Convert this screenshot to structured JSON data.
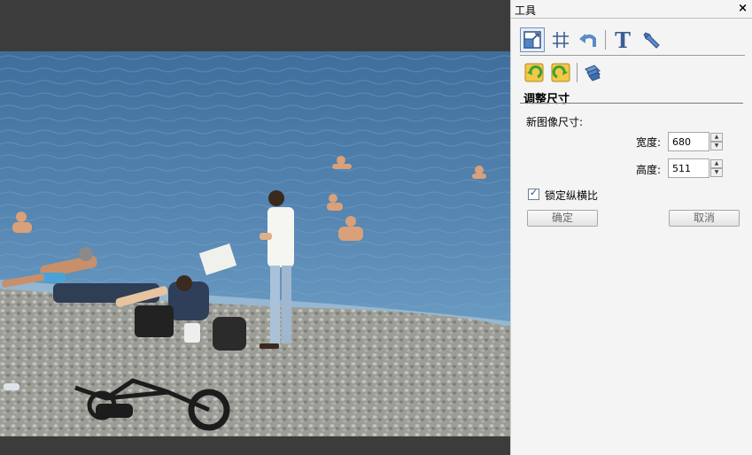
{
  "panel": {
    "title": "工具",
    "close_glyph": "×"
  },
  "toolbar": {
    "row1": [
      {
        "name": "resize-icon",
        "active": true
      },
      {
        "name": "crop-icon",
        "active": false
      },
      {
        "name": "undo-icon",
        "active": false
      },
      {
        "name": "text-icon",
        "label": "T"
      },
      {
        "name": "wrench-icon"
      }
    ],
    "row2": [
      {
        "name": "rotate-left-icon"
      },
      {
        "name": "rotate-right-icon"
      },
      {
        "name": "effects-icon"
      }
    ]
  },
  "resize": {
    "section_title": "调整尺寸",
    "new_size_label": "新图像尺寸:",
    "width_label": "宽度:",
    "width_value": "680",
    "height_label": "高度:",
    "height_value": "511",
    "lock_ratio_label": "锁定纵横比",
    "lock_ratio_checked": true,
    "ok_label": "确定",
    "cancel_label": "取消"
  },
  "colors": {
    "canvas_bg": "#3c3c3c",
    "panel_bg": "#f4f4f4",
    "sea": "#4a7aa6",
    "pebbles": "#9b9b96",
    "accent_blue": "#2f4d86"
  }
}
